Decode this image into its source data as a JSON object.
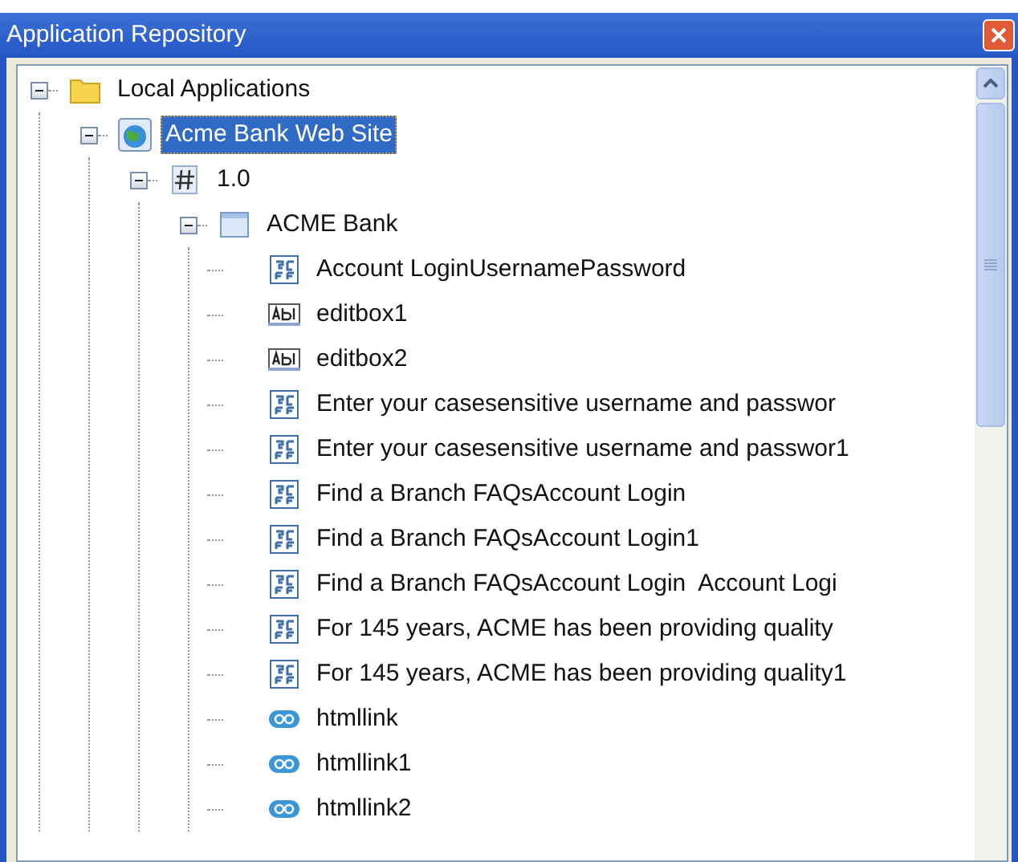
{
  "window": {
    "title": "Application Repository"
  },
  "tree": [
    {
      "label": "Local Applications",
      "kind": "folder",
      "expanded": true,
      "selected": false,
      "children": [
        {
          "label": "Acme Bank Web Site",
          "kind": "website",
          "expanded": true,
          "selected": true,
          "children": [
            {
              "label": "1.0",
              "kind": "version",
              "expanded": true,
              "selected": false,
              "children": [
                {
                  "label": "ACME Bank",
                  "kind": "page",
                  "expanded": true,
                  "selected": false,
                  "children": [
                    {
                      "label": "Account LoginUsernamePassword",
                      "kind": "form",
                      "selected": false
                    },
                    {
                      "label": "editbox1",
                      "kind": "editbox",
                      "selected": false
                    },
                    {
                      "label": "editbox2",
                      "kind": "editbox",
                      "selected": false
                    },
                    {
                      "label": "Enter your casesensitive username and passwor",
                      "kind": "form",
                      "selected": false
                    },
                    {
                      "label": "Enter your casesensitive username and passwor1",
                      "kind": "form",
                      "selected": false
                    },
                    {
                      "label": "Find a Branch FAQsAccount Login",
                      "kind": "form",
                      "selected": false
                    },
                    {
                      "label": "Find a Branch FAQsAccount Login1",
                      "kind": "form",
                      "selected": false
                    },
                    {
                      "label": "Find a Branch FAQsAccount Login  Account Logi",
                      "kind": "form",
                      "selected": false
                    },
                    {
                      "label": "For 145 years, ACME has been providing quality",
                      "kind": "form",
                      "selected": false
                    },
                    {
                      "label": "For 145 years, ACME has been providing quality1",
                      "kind": "form",
                      "selected": false
                    },
                    {
                      "label": "htmllink",
                      "kind": "link",
                      "selected": false
                    },
                    {
                      "label": "htmllink1",
                      "kind": "link",
                      "selected": false
                    },
                    {
                      "label": "htmllink2",
                      "kind": "link",
                      "selected": false
                    }
                  ]
                }
              ]
            }
          ]
        }
      ]
    }
  ]
}
